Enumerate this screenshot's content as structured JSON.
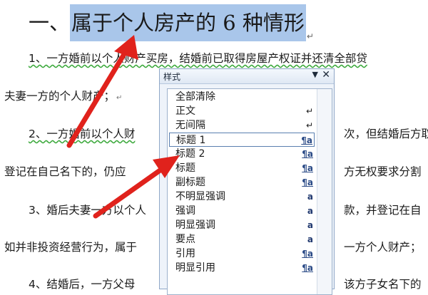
{
  "document": {
    "heading_prefix": "一、",
    "heading_title": "属于个人房产的 6 种情形",
    "paragraph_mark": "↵",
    "paragraphs": [
      "1、一方婚前以个人财产买房，结婚前已取得房屋产权证并还清全部贷",
      "夫妻一方的个人财产；",
      "2、一方婚前以个人财",
      "次，但结婚后方取",
      "登记在自己名下的，仍应",
      "方无权要求分割",
      "3、婚后夫妻一方以个人",
      "款，并登记在自",
      "如并非投资经营行为，属于",
      "一方个人财产；",
      "4、结婚后，一方父母",
      "该方子女名下的"
    ]
  },
  "styles_pane": {
    "title": "样式",
    "menu_icon": "▼",
    "close_icon": "✕",
    "items": [
      {
        "label": "全部清除",
        "icon": ""
      },
      {
        "label": "正文",
        "icon": "↵"
      },
      {
        "label": "无间隔",
        "icon": "↵"
      },
      {
        "label": "标题 1",
        "icon": "¶a"
      },
      {
        "label": "标题 2",
        "icon": "¶a"
      },
      {
        "label": "标题",
        "icon": "¶a"
      },
      {
        "label": "副标题",
        "icon": "¶a"
      },
      {
        "label": "不明显强调",
        "icon": "a"
      },
      {
        "label": "强调",
        "icon": "a"
      },
      {
        "label": "明显强调",
        "icon": "a"
      },
      {
        "label": "要点",
        "icon": "a"
      },
      {
        "label": "引用",
        "icon": "¶a"
      },
      {
        "label": "明显引用",
        "icon": "¶a"
      }
    ],
    "selected_index": 3
  },
  "colors": {
    "highlight": "#a9c6ea",
    "arrow": "#e0221c",
    "pane_background": "#eef3fa"
  }
}
